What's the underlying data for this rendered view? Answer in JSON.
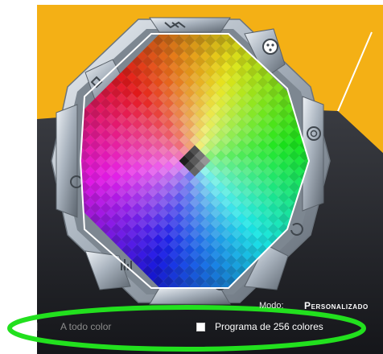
{
  "mode": {
    "label": "Modo:",
    "value": "Personalizado"
  },
  "options": [
    {
      "label": "A todo color",
      "selected": false
    },
    {
      "label": "Programa de 256 colores",
      "checked": false
    }
  ],
  "colors": {
    "background_top": "#f4b015",
    "background_bottom": "#1c1c20",
    "highlight_ring": "#22e01e",
    "frame": "#b9c4cf"
  },
  "side_buttons": [
    {
      "icon": "shuffle-icon"
    },
    {
      "icon": "palette-icon"
    },
    {
      "icon": "spiral-icon"
    },
    {
      "icon": "refresh-icon"
    },
    {
      "icon": "leaf-icon"
    },
    {
      "icon": "equalizer-icon"
    },
    {
      "icon": "music-note-icon"
    },
    {
      "icon": "diamond-icon"
    }
  ]
}
